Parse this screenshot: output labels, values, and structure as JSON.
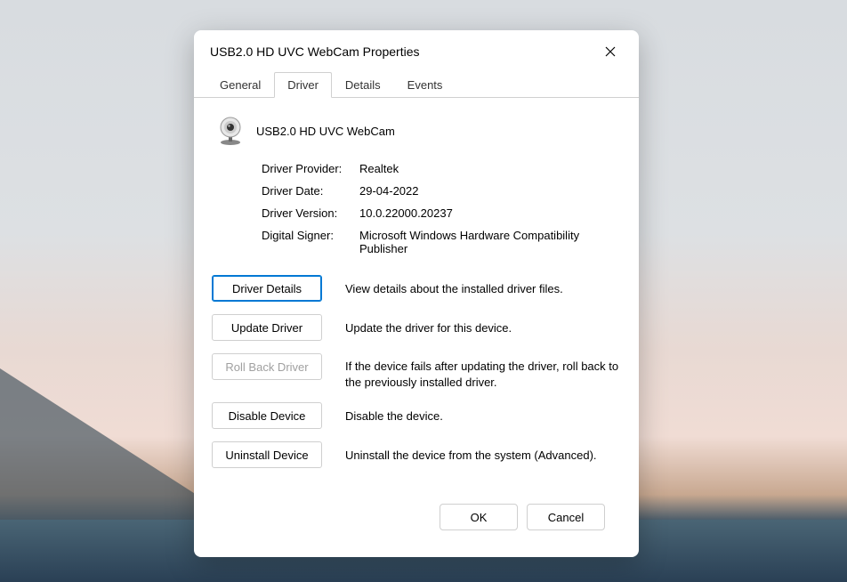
{
  "window": {
    "title": "USB2.0 HD UVC WebCam Properties"
  },
  "tabs": {
    "general": "General",
    "driver": "Driver",
    "details": "Details",
    "events": "Events"
  },
  "device": {
    "name": "USB2.0 HD UVC WebCam"
  },
  "info": {
    "provider_label": "Driver Provider:",
    "provider_value": "Realtek",
    "date_label": "Driver Date:",
    "date_value": "29-04-2022",
    "version_label": "Driver Version:",
    "version_value": "10.0.22000.20237",
    "signer_label": "Digital Signer:",
    "signer_value": "Microsoft Windows Hardware Compatibility Publisher"
  },
  "actions": {
    "details_label": "Driver Details",
    "details_desc": "View details about the installed driver files.",
    "update_label": "Update Driver",
    "update_desc": "Update the driver for this device.",
    "rollback_label": "Roll Back Driver",
    "rollback_desc": "If the device fails after updating the driver, roll back to the previously installed driver.",
    "disable_label": "Disable Device",
    "disable_desc": "Disable the device.",
    "uninstall_label": "Uninstall Device",
    "uninstall_desc": "Uninstall the device from the system (Advanced)."
  },
  "footer": {
    "ok": "OK",
    "cancel": "Cancel"
  }
}
